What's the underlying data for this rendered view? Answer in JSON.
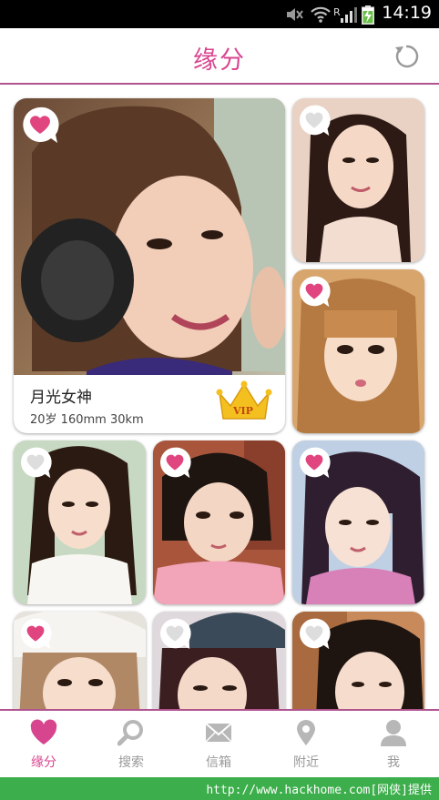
{
  "status_bar": {
    "time": "14:19",
    "icons": [
      "mute-icon",
      "wifi-icon",
      "roaming-r-icon",
      "signal-icon",
      "battery-charging-icon"
    ]
  },
  "header": {
    "title": "缘分",
    "refresh_icon": "refresh-icon"
  },
  "featured": {
    "name": "月光女神",
    "stats": "20岁  160mm  30km",
    "badge": "VIP",
    "liked": true
  },
  "profiles": [
    {
      "id": "p2",
      "liked": false
    },
    {
      "id": "p3",
      "liked": true
    },
    {
      "id": "p4",
      "liked": false
    },
    {
      "id": "p5",
      "liked": true
    },
    {
      "id": "p6",
      "liked": true
    },
    {
      "id": "p7",
      "liked": true
    },
    {
      "id": "p8",
      "liked": false
    },
    {
      "id": "p9",
      "liked": false
    }
  ],
  "nav": {
    "items": [
      {
        "label": "缘分",
        "icon": "heart-icon",
        "active": true
      },
      {
        "label": "搜索",
        "icon": "search-icon",
        "active": false
      },
      {
        "label": "信箱",
        "icon": "mail-icon",
        "active": false
      },
      {
        "label": "附近",
        "icon": "location-pin-icon",
        "active": false
      },
      {
        "label": "我",
        "icon": "person-icon",
        "active": false
      }
    ]
  },
  "watermark": "http://www.hackhome.com[网侠]提供",
  "colors": {
    "accent": "#d8458f",
    "divider": "#b0538f",
    "inactive": "#b7b7b7",
    "watermark_bg": "#3cae4b"
  }
}
